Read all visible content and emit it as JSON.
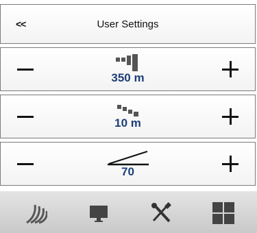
{
  "header": {
    "back_label": "<<",
    "title": "User Settings"
  },
  "settings": [
    {
      "icon": "bar-height-icon",
      "value": "350 m"
    },
    {
      "icon": "step-distance-icon",
      "value": "10 m"
    },
    {
      "icon": "slope-angle-icon",
      "value": "70"
    }
  ],
  "toolbar": {
    "items": [
      "signal-waves-icon",
      "monitor-icon",
      "tools-icon",
      "grid-icon"
    ]
  },
  "colors": {
    "value_text": "#1d3f7a",
    "icon_gray": "#555555",
    "toolbar_bg": "#d6d6d6"
  }
}
